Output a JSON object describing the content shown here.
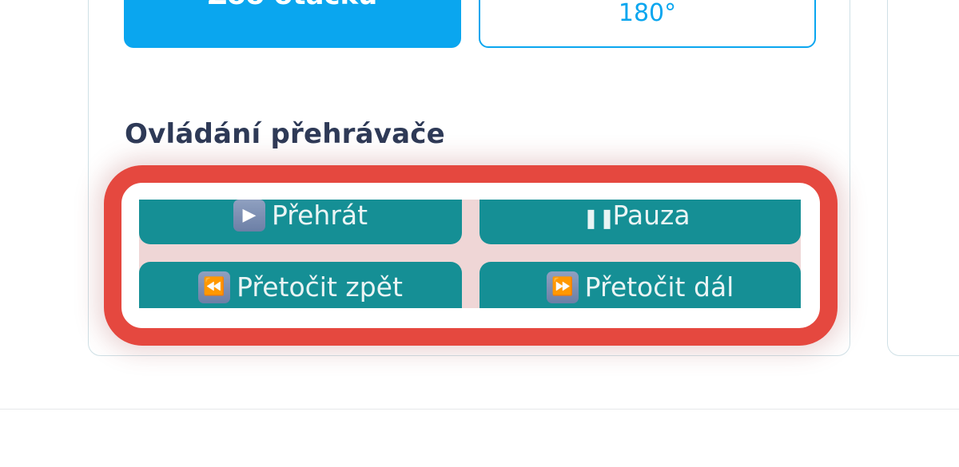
{
  "top_buttons": {
    "primary_label": "Zoo otáčku",
    "outline_label": "180°"
  },
  "player": {
    "section_title": "Ovládání přehrávače",
    "play_label": "Přehrát",
    "pause_label": "Pauza",
    "rewind_label": "Přetočit zpět",
    "forward_label": "Přetočit dál"
  },
  "icons": {
    "play": "▶",
    "pause": "⏸",
    "rewind": "⏪",
    "forward": "⏩"
  },
  "colors": {
    "accent_blue": "#0aa6ef",
    "player_teal": "#158f95",
    "highlight_red": "#e5483f",
    "title_navy": "#2e3a57"
  }
}
